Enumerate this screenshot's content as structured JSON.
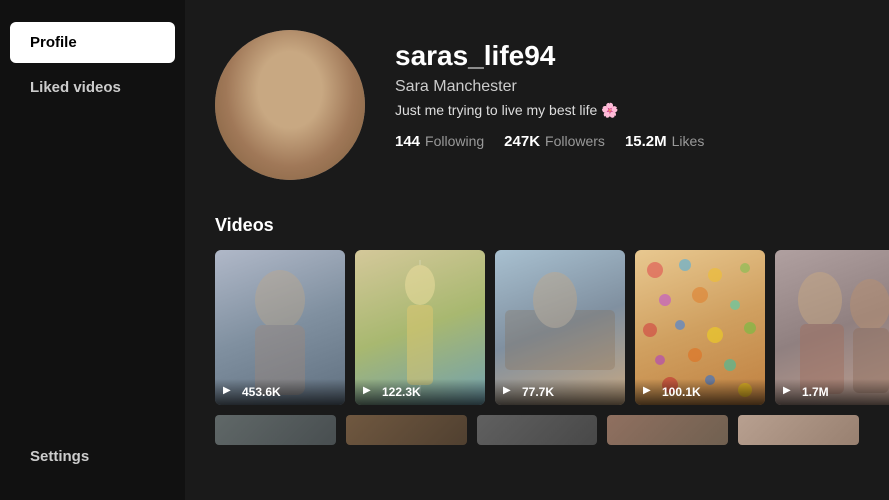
{
  "sidebar": {
    "items": [
      {
        "id": "profile",
        "label": "Profile",
        "active": true
      },
      {
        "id": "liked-videos",
        "label": "Liked videos",
        "active": false
      }
    ],
    "bottom": {
      "label": "Settings"
    }
  },
  "profile": {
    "username": "saras_life94",
    "display_name": "Sara Manchester",
    "bio": "Just me trying to live my best life 🌸",
    "stats": {
      "following": {
        "count": "144",
        "label": "Following"
      },
      "followers": {
        "count": "247K",
        "label": "Followers"
      },
      "likes": {
        "count": "15.2M",
        "label": "Likes"
      }
    }
  },
  "videos_section": {
    "title": "Videos",
    "items": [
      {
        "id": "v1",
        "view_count": "453.6K"
      },
      {
        "id": "v2",
        "view_count": "122.3K"
      },
      {
        "id": "v3",
        "view_count": "77.7K"
      },
      {
        "id": "v4",
        "view_count": "100.1K"
      },
      {
        "id": "v5",
        "view_count": "1.7M"
      }
    ]
  },
  "icons": {
    "play": "▶"
  }
}
